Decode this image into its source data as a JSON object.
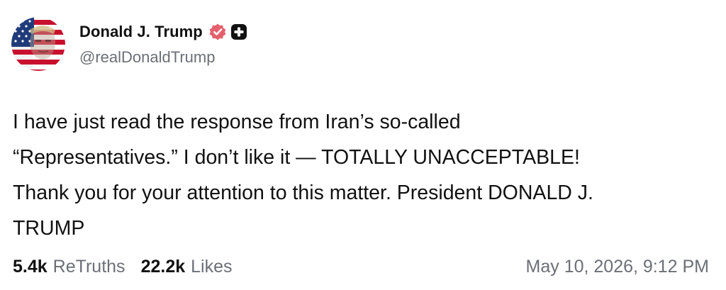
{
  "post": {
    "author": {
      "display_name": "Donald J. Trump",
      "handle": "@realDonaldTrump",
      "verified_icon": "verified-badge-icon",
      "plus_icon": "plus-badge-icon",
      "avatar": "avatar-image"
    },
    "text": "I have just read the response from Iran’s so-called\n“Representatives.” I don’t like it — TOTALLY UNACCEPTABLE!\nThank you for your attention to this matter. President DONALD J.\nTRUMP",
    "stats": {
      "retruths_count": "5.4k",
      "retruths_label": "ReTruths",
      "likes_count": "22.2k",
      "likes_label": "Likes"
    },
    "timestamp": "May 10, 2026, 9:12 PM"
  },
  "colors": {
    "text": "#111111",
    "muted": "#6b6f76",
    "verified_badge": "#e4606d",
    "plus_badge": "#111111",
    "background": "#ffffff"
  }
}
